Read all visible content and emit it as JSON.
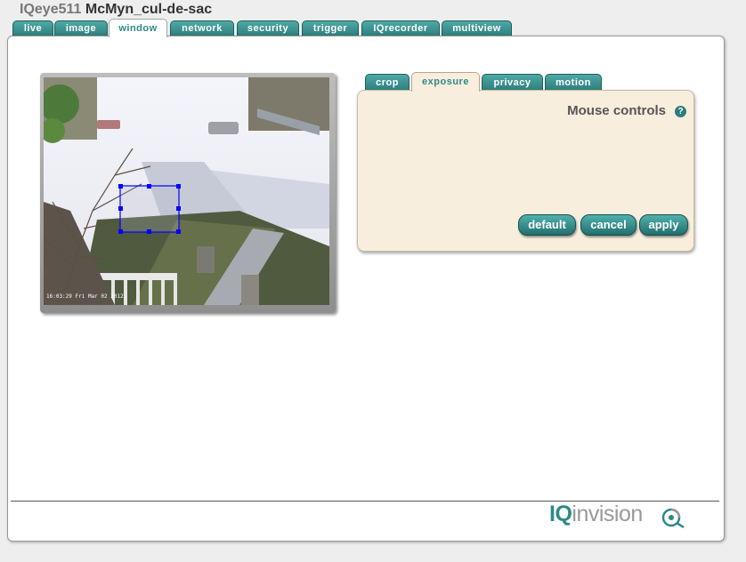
{
  "header": {
    "model": "IQeye511",
    "camera_name": "McMyn_cul-de-sac"
  },
  "main_tabs": [
    {
      "label": "live"
    },
    {
      "label": "image"
    },
    {
      "label": "window"
    },
    {
      "label": "network"
    },
    {
      "label": "security"
    },
    {
      "label": "trigger"
    },
    {
      "label": "IQrecorder"
    },
    {
      "label": "multiview"
    }
  ],
  "active_main_tab": "window",
  "sub_tabs": [
    {
      "label": "crop"
    },
    {
      "label": "exposure"
    },
    {
      "label": "privacy"
    },
    {
      "label": "motion"
    }
  ],
  "active_sub_tab": "exposure",
  "controls": {
    "title": "Mouse controls",
    "help_glyph": "?",
    "buttons": {
      "default": "default",
      "cancel": "cancel",
      "apply": "apply"
    }
  },
  "camera": {
    "timestamp": "16:03:29 Fri Mar 02 2012"
  },
  "logo": {
    "bold": "IQ",
    "light": "invision"
  },
  "colors": {
    "tab_teal": "#2c7d7b",
    "active_text": "#2c8a88",
    "control_bg": "#f8eedd",
    "selection_box": "#0000ff"
  },
  "icons": {
    "help": "help-icon",
    "logo_mark": "iqinvision-q-icon"
  }
}
